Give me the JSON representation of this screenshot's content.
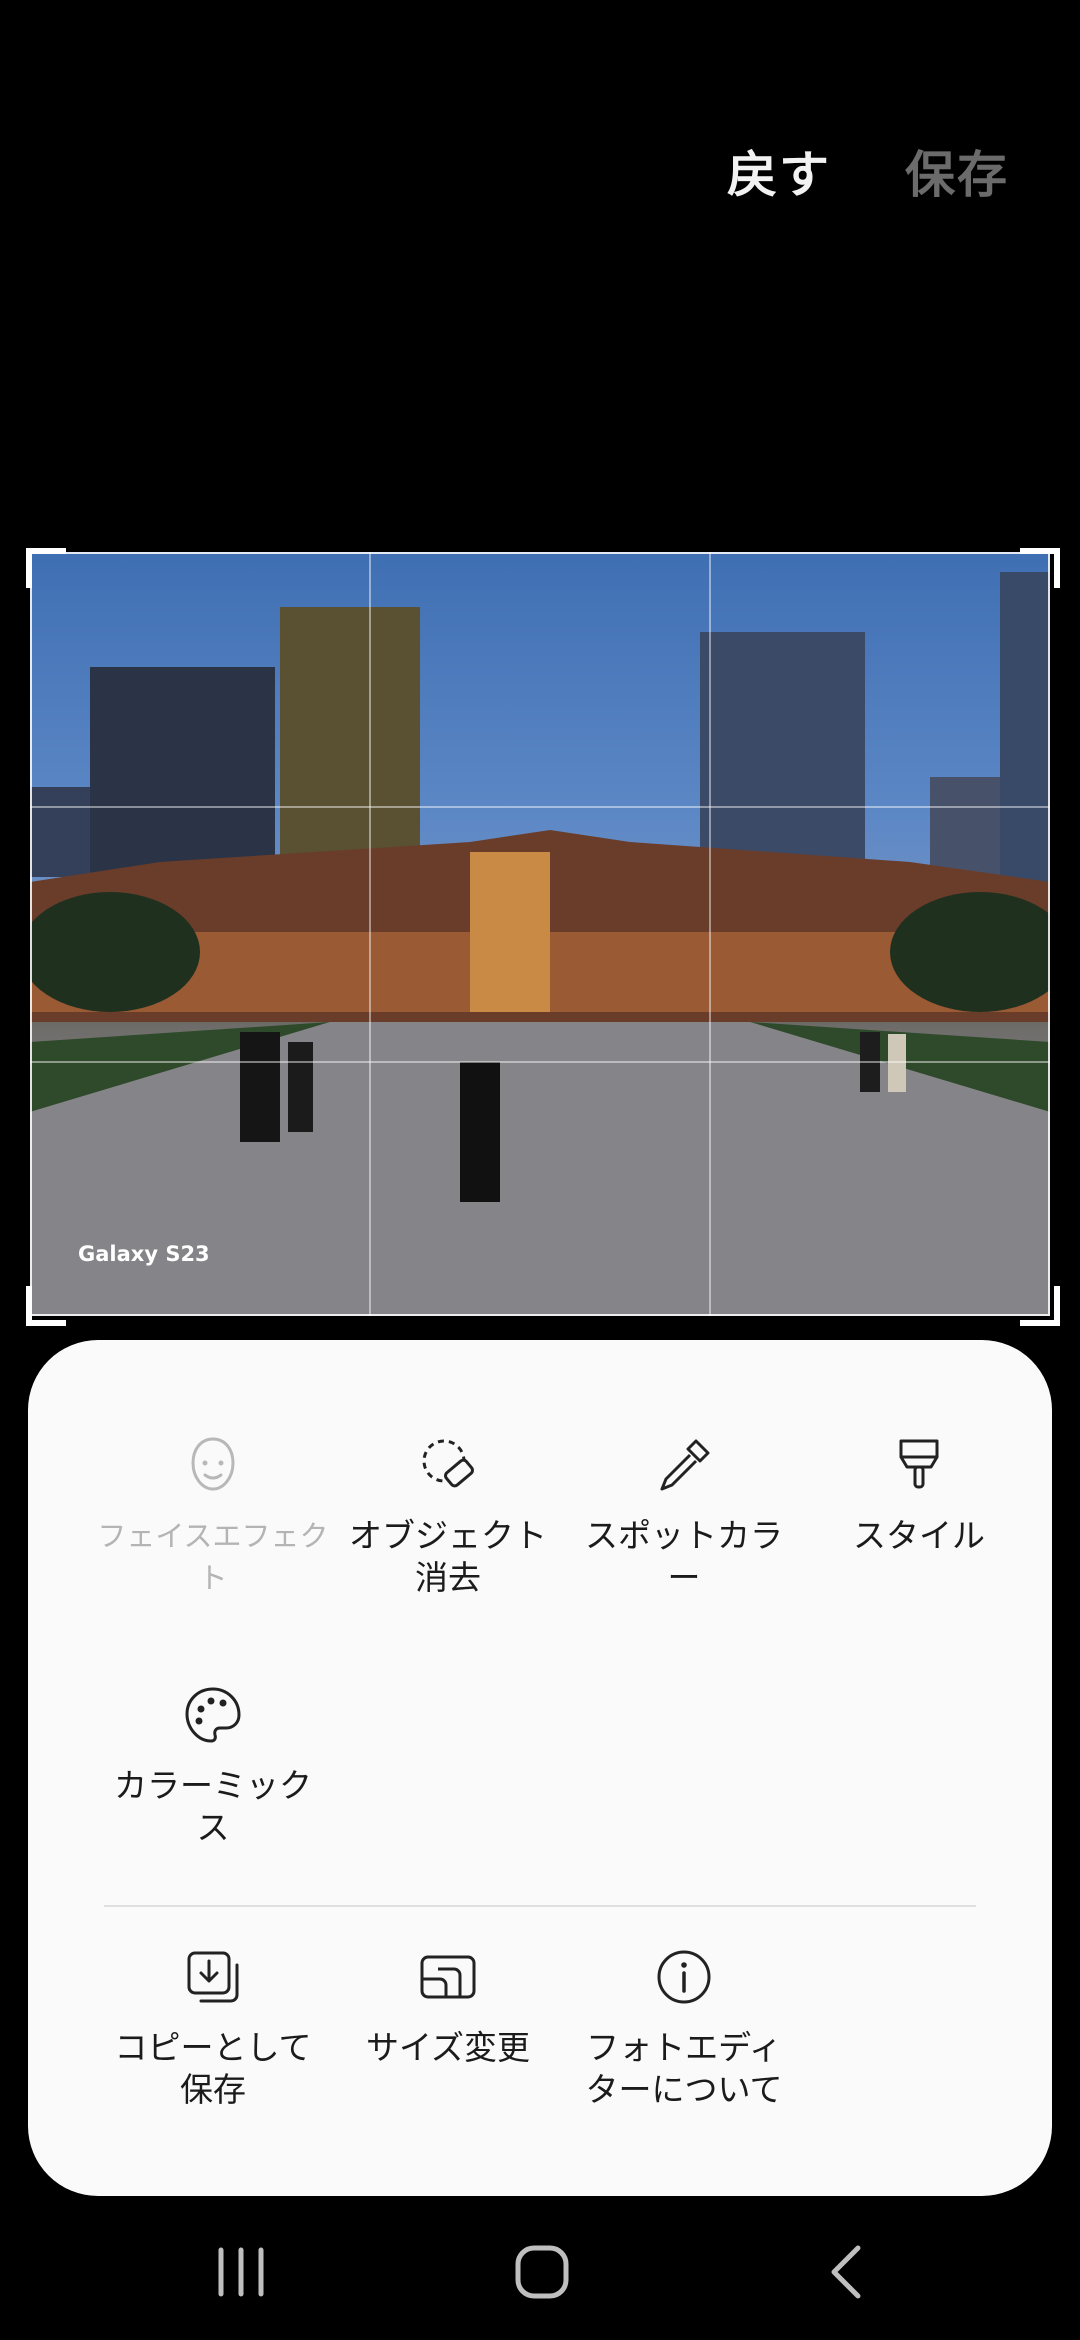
{
  "header": {
    "revert_label": "戻す",
    "save_label": "保存"
  },
  "photo": {
    "watermark": "Galaxy S23"
  },
  "tools": {
    "face_effect": "フェイスエフェクト",
    "object_eraser": "オブジェクト\n消去",
    "spot_color": "スポットカラ\nー",
    "style": "スタイル",
    "color_mix": "カラーミック\nス"
  },
  "actions": {
    "copy_save": "コピーとして\n保存",
    "resize": "サイズ変更",
    "about": "フォトエディ\nターについて"
  },
  "nav": {
    "recents_icon": "recents-icon",
    "home_icon": "home-icon",
    "back_icon": "back-icon"
  },
  "colors": {
    "background": "#000000",
    "sheet": "#fafafa",
    "disabled_text": "#b4b4b4"
  }
}
